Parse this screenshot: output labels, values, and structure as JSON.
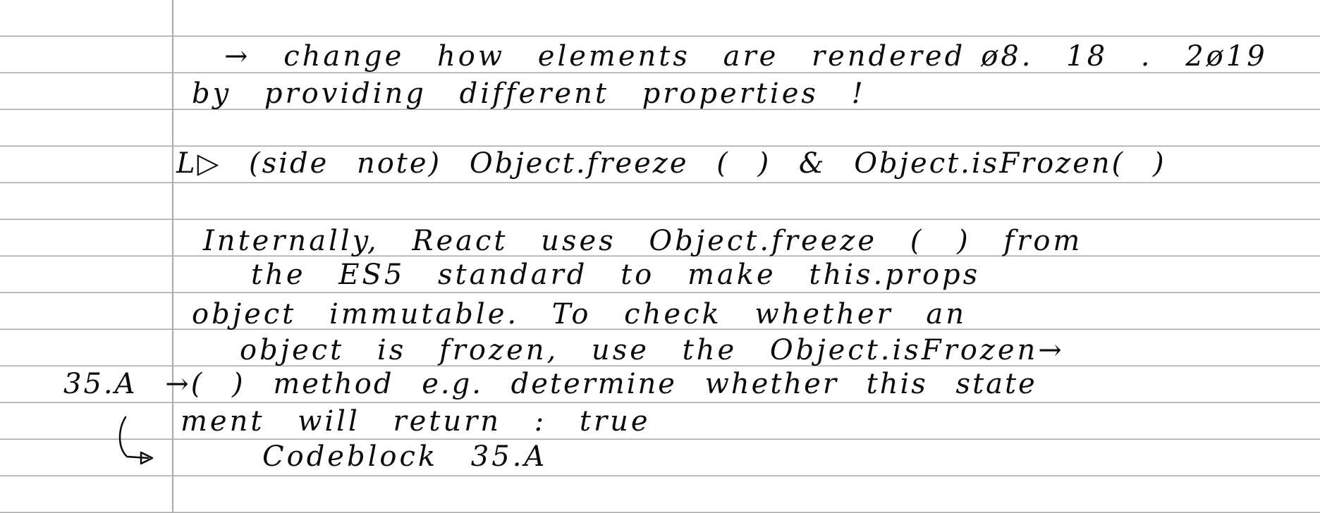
{
  "notes": {
    "line1": "→  change  how  elements  are  rendered",
    "date": "ø8. 18 . 2ø19",
    "line2": "by  providing  different  properties !",
    "line3": "L▷ (side note)  Object.freeze ( )  &  Object.isFrozen( )",
    "line4": "Internally,  React  uses  Object.freeze ( )  from",
    "line5": "the  ES5  standard  to  make  this.props",
    "line6": "object  immutable.  To  check  whether  an",
    "line7": "object  is  frozen,  use  the  Object.isFrozen→",
    "line8": "35.A  →( )  method  e.g.  determine  whether  this state",
    "line9": "ment  will  return :  true",
    "line10": "Codeblock   35.A"
  },
  "icons": {
    "hook_arrow": "hook-arrow-icon"
  },
  "colors": {
    "ink": "#0b0b0b",
    "rule": "#a7a7a7",
    "paper": "#ffffff"
  }
}
